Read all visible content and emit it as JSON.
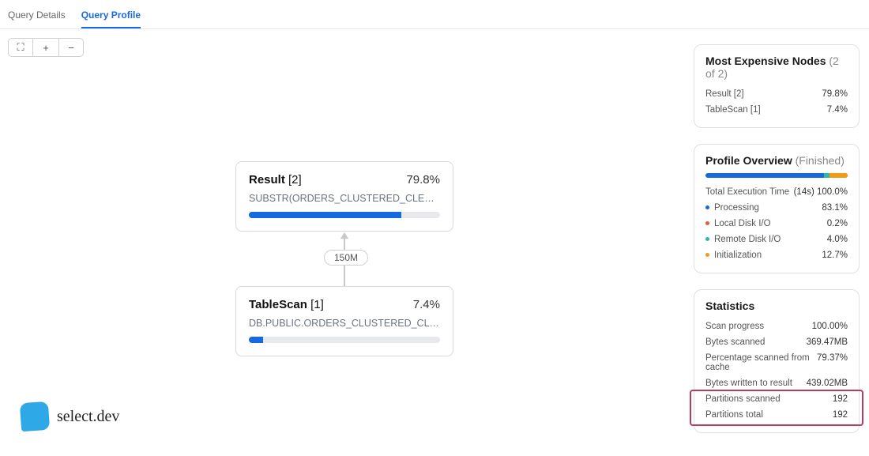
{
  "tabs": {
    "details": "Query Details",
    "profile": "Query Profile"
  },
  "toolbar": {
    "fullscreen": "⛶",
    "zoom_in": "+",
    "zoom_out": "−"
  },
  "graph": {
    "edge_label": "150M",
    "result": {
      "name": "Result",
      "id": "[2]",
      "pct_label": "79.8%",
      "pct": 79.8,
      "sub": "SUBSTR(ORDERS_CLUSTERED_CLERK_…"
    },
    "tablescan": {
      "name": "TableScan",
      "id": "[1]",
      "pct_label": "7.4%",
      "pct": 7.4,
      "sub": "DB.PUBLIC.ORDERS_CLUSTERED_CLER…"
    }
  },
  "expensive": {
    "title": "Most Expensive Nodes",
    "count": "(2 of 2)",
    "rows": [
      {
        "label": "Result [2]",
        "val": "79.8%"
      },
      {
        "label": "TableScan [1]",
        "val": "7.4%"
      }
    ]
  },
  "overview": {
    "title": "Profile Overview",
    "status": "(Finished)",
    "total_label": "Total Execution Time",
    "total_val": "(14s) 100.0%",
    "rows": [
      {
        "dot": "blue",
        "label": "Processing",
        "val": "83.1%"
      },
      {
        "dot": "red",
        "label": "Local Disk I/O",
        "val": "0.2%"
      },
      {
        "dot": "teal",
        "label": "Remote Disk I/O",
        "val": "4.0%"
      },
      {
        "dot": "orange",
        "label": "Initialization",
        "val": "12.7%"
      }
    ]
  },
  "stats": {
    "title": "Statistics",
    "rows": [
      {
        "label": "Scan progress",
        "val": "100.00%"
      },
      {
        "label": "Bytes scanned",
        "val": "369.47MB"
      },
      {
        "label": "Percentage scanned from cache",
        "val": "79.37%"
      },
      {
        "label": "Bytes written to result",
        "val": "439.02MB"
      },
      {
        "label": "Partitions scanned",
        "val": "192"
      },
      {
        "label": "Partitions total",
        "val": "192"
      }
    ]
  },
  "logo": {
    "text": "select.dev"
  }
}
